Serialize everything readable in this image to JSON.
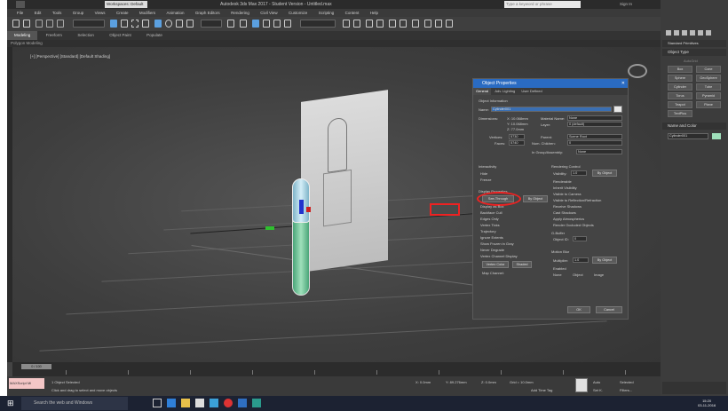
{
  "window": {
    "title": "Autodesk 3ds Max 2017 - Student Version - Untitled.max",
    "workspace": "Workspaces: Default",
    "search_placeholder": "Type a keyword or phrase",
    "user": "Sign In"
  },
  "menu": [
    "File",
    "Edit",
    "Tools",
    "Group",
    "Views",
    "Create",
    "Modifiers",
    "Animation",
    "Graph Editors",
    "Rendering",
    "Civil View",
    "Customize",
    "Scripting",
    "Content",
    "Help"
  ],
  "ribbon": {
    "tabs": [
      "Modeling",
      "Freeform",
      "Selection",
      "Object Paint",
      "Populate"
    ],
    "active": "Modeling",
    "sub_label": "Polygon Modeling"
  },
  "viewport": {
    "label": "[+] [Perspective] [Standard] [Default Shading]"
  },
  "dialog": {
    "title": "Object Properties",
    "tabs": [
      "General",
      "Adv. Lighting",
      "User Defined"
    ],
    "section_info": "Object Information",
    "name_label": "Name:",
    "name_value": "Cylinder001",
    "dimensions_label": "Dimensions:",
    "dims": [
      "X: 10.068mm",
      "Y: 10.068mm",
      "Z: 77.0mm"
    ],
    "material_label": "Material Name:",
    "material_value": "None",
    "layer_label": "Layer:",
    "layer_value": "0 (default)",
    "vertices_label": "Vertices:",
    "vertices_value": "5730",
    "faces_label": "Faces:",
    "faces_value": "5740",
    "parent_label": "Parent:",
    "parent_value": "Scene Root",
    "children_label": "Num. Children:",
    "children_value": "0",
    "group_label": "In Group/Assembly:",
    "group_value": "None",
    "interactivity": "Interactivity",
    "hide": "Hide",
    "freeze": "Freeze",
    "display_props": "Display Properties",
    "see_through": "See-Through",
    "by_object": "By Object",
    "display_items": [
      "Display as Box",
      "Backface Cull",
      "Edges Only",
      "Vertex Ticks",
      "Trajectory",
      "Ignore Extents",
      "Show Frozen in Gray",
      "Never Degrade",
      "Vertex Channel Display"
    ],
    "rendering_control": "Rendering Control",
    "visibility_label": "Visibility:",
    "visibility_value": "1.0",
    "render_items": [
      "Renderable",
      "Inherit Visibility",
      "Visible to Camera",
      "Visible to Reflection/Refraction",
      "Receive Shadows",
      "Cast Shadows",
      "Apply Atmospherics",
      "Render Occluded Objects"
    ],
    "gbuffer": "G-Buffer",
    "object_id_label": "Object ID:",
    "object_id_value": "0",
    "motion_blur": "Motion Blur",
    "multiplier_label": "Multiplier:",
    "multiplier_value": "1.0",
    "enabled": "Enabled",
    "blur_opts": [
      "None",
      "Object",
      "Image"
    ],
    "vertex_color": "Vertex Color",
    "shaded": "Shaded",
    "map_channel_label": "Map Channel:",
    "ok": "OK",
    "cancel": "Cancel"
  },
  "right_panel": {
    "dropdown": "Standard Primitives",
    "section_object_type": "Object Type",
    "autogrid": "AutoGrid",
    "buttons": [
      "Box",
      "Cone",
      "Sphere",
      "GeoSphere",
      "Cylinder",
      "Tube",
      "Torus",
      "Pyramid",
      "Teapot",
      "Plane",
      "TextPlus"
    ],
    "section_name_color": "Name and Color",
    "name_value": "Cylinder001"
  },
  "timeline": {
    "slider": "0 / 100",
    "frames": [
      "0",
      "10",
      "20",
      "30",
      "40",
      "50",
      "60",
      "70",
      "80",
      "90",
      "100"
    ]
  },
  "status": {
    "maxscript": "MAXScript Mi",
    "selected": "1 Object Selected",
    "prompt": "Click and drag to select and move objects",
    "x": "X: 0.0mm",
    "y": "Y: 89.276mm",
    "z": "Z: 0.0mm",
    "grid": "Grid = 10.0mm",
    "add_time_tag": "Add Time Tag",
    "auto": "Auto",
    "selected_btn": "Selected",
    "set_k": "Set K.",
    "filters": "Filters..."
  },
  "taskbar": {
    "search": "Search the web and Windows",
    "time": "15:20",
    "date": "03-11-2016"
  }
}
